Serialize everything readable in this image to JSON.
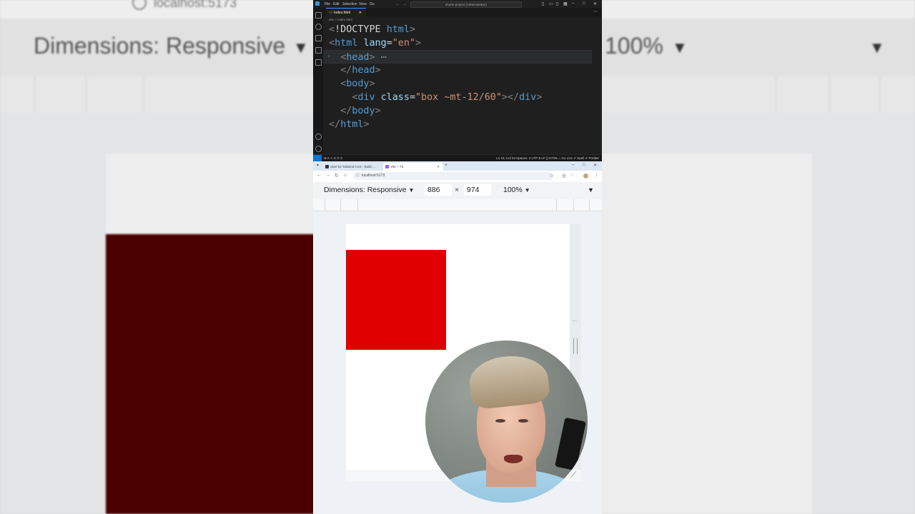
{
  "background": {
    "url": "localhost:5173",
    "dimensions_label": "Dimensions: Responsive",
    "zoom_label": "100%"
  },
  "editor": {
    "menu": [
      "File",
      "Edit",
      "Selection",
      "View",
      "Go"
    ],
    "command_center": "shorts-project (Administrator)",
    "tab_label": "index.html",
    "breadcrumb": "vite > index.html",
    "code_lines": [
      {
        "parts": [
          [
            "punc",
            "<"
          ],
          [
            "txt",
            "!DOCTYPE "
          ],
          [
            "tag",
            "html"
          ],
          [
            "punc",
            ">"
          ]
        ]
      },
      {
        "parts": [
          [
            "punc",
            "<"
          ],
          [
            "tag",
            "html "
          ],
          [
            "attr",
            "lang"
          ],
          [
            "txt",
            "="
          ],
          [
            "str",
            "\"en\""
          ],
          [
            "punc",
            ">"
          ]
        ]
      },
      {
        "parts": [
          [
            "punc",
            "<"
          ],
          [
            "tag",
            "head"
          ],
          [
            "punc",
            "> "
          ],
          [
            "dots",
            "⋯"
          ]
        ]
      },
      {
        "parts": [
          [
            "punc",
            "</"
          ],
          [
            "tag",
            "head"
          ],
          [
            "punc",
            ">"
          ]
        ]
      },
      {
        "parts": [
          [
            "punc",
            "<"
          ],
          [
            "tag",
            "body"
          ],
          [
            "punc",
            ">"
          ]
        ]
      },
      {
        "parts": [
          [
            "punc",
            "<"
          ],
          [
            "tag",
            "div "
          ],
          [
            "attr",
            "class"
          ],
          [
            "txt",
            "="
          ],
          [
            "str",
            "\"box ~mt-12/60\""
          ],
          [
            "punc",
            "></"
          ],
          [
            "tag",
            "div"
          ],
          [
            "punc",
            ">"
          ]
        ]
      },
      {
        "parts": [
          [
            "punc",
            "</"
          ],
          [
            "tag",
            "body"
          ],
          [
            "punc",
            ">"
          ]
        ]
      },
      {
        "parts": [
          [
            "punc",
            "</"
          ],
          [
            "tag",
            "html"
          ],
          [
            "punc",
            ">"
          ]
        ]
      }
    ],
    "status_left": "⊗ 0 ⚠ 0   ⓦ 0",
    "status_right": "Ln 10, Col 33   Spaces: 2   UTF-8   LF   {} HTML   ⌂ Go Live   ✔ Spell   ✔ Prettier"
  },
  "browser": {
    "tabs": [
      {
        "label": "Start for Tailwind CSS - Build ...",
        "active": false
      },
      {
        "label": "Vite + TS",
        "active": true
      }
    ],
    "url": "localhost:5173",
    "device_toolbar": {
      "dimensions": "Dimensions: Responsive",
      "width": "886",
      "height": "974",
      "zoom": "100%"
    }
  },
  "colors": {
    "box": "#e10000",
    "editor_bg": "#1f1f1f",
    "accent": "#0078d4"
  }
}
